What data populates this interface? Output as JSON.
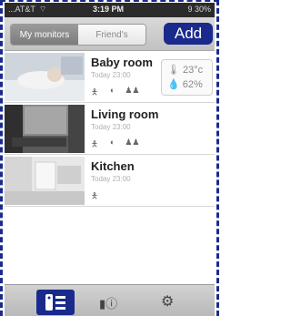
{
  "status": {
    "carrier": "...AT&T",
    "time": "3:19 PM",
    "battery": "9 30%"
  },
  "segments": {
    "left": "My monitors",
    "right": "Friend's"
  },
  "add_label": "Add",
  "rooms": [
    {
      "name": "Baby room",
      "time": "Today 23:00",
      "temp": "23°c",
      "humidity": "62%"
    },
    {
      "name": "Living room",
      "time": "Today 23:00"
    },
    {
      "name": "Kitchen",
      "time": "Today 23:00"
    }
  ],
  "icons": {
    "room_icons": [
      "person-icon",
      "sound-icon",
      "people-icon"
    ],
    "tabs": [
      "monitors-list-icon",
      "device-info-icon",
      "settings-gear-icon"
    ]
  },
  "colors": {
    "accent": "#1a2a8c"
  }
}
